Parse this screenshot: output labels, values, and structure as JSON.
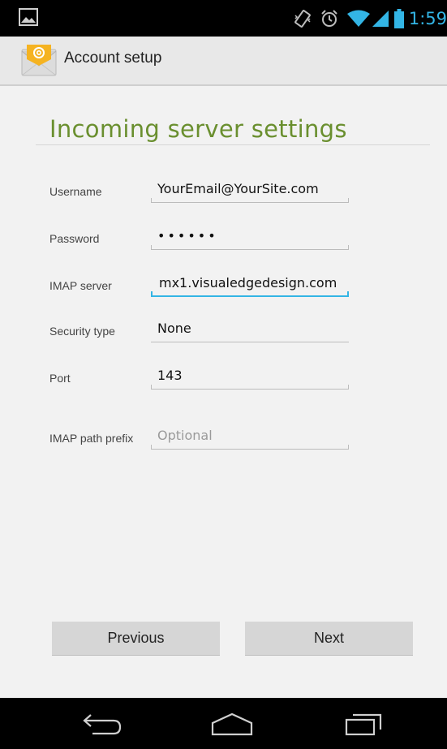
{
  "status_bar": {
    "time": "1:59",
    "accent_color": "#33b5e5",
    "icons": [
      "image-notification-icon",
      "vibrate-icon",
      "alarm-icon",
      "wifi-icon",
      "signal-icon",
      "battery-icon"
    ]
  },
  "action_bar": {
    "title": "Account setup",
    "icon": "email-app-icon"
  },
  "page": {
    "heading": "Incoming server settings",
    "heading_color": "#6a8f2f"
  },
  "form": {
    "username": {
      "label": "Username",
      "value": "YourEmail@YourSite.com"
    },
    "password": {
      "label": "Password",
      "value": "••••••"
    },
    "imap_server": {
      "label": "IMAP server",
      "value": "mx1.visualedgedesign.com"
    },
    "security_type": {
      "label": "Security type",
      "value": "None"
    },
    "port": {
      "label": "Port",
      "value": "143"
    },
    "imap_path_prefix": {
      "label": "IMAP path prefix",
      "value": "",
      "placeholder": "Optional"
    }
  },
  "buttons": {
    "previous": "Previous",
    "next": "Next"
  },
  "nav_bar": {
    "icons": [
      "back-icon",
      "home-icon",
      "recent-apps-icon"
    ]
  }
}
